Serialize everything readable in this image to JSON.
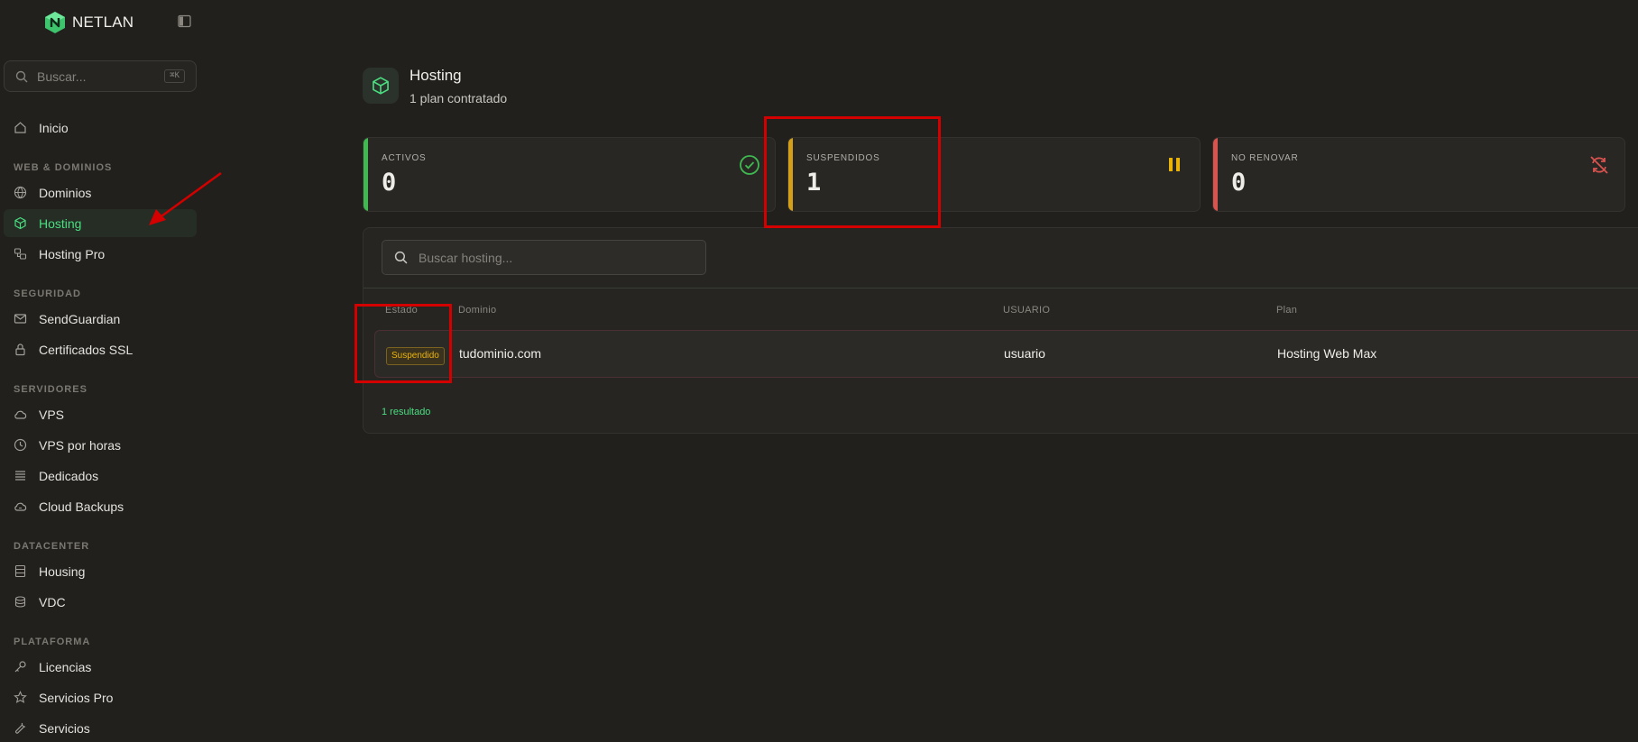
{
  "brand": {
    "name": "NETLAN"
  },
  "sidebar": {
    "search_placeholder": "Buscar...",
    "search_shortcut": "⌘K",
    "home_label": "Inicio",
    "sections": [
      "WEB & DOMINIOS",
      "SEGURIDAD",
      "SERVIDORES",
      "DATACENTER",
      "PLATAFORMA"
    ],
    "items": [
      {
        "label": "Dominios",
        "icon": "globe-icon"
      },
      {
        "label": "Hosting",
        "icon": "cube-icon",
        "active": true
      },
      {
        "label": "Hosting Pro",
        "icon": "server-stack-icon"
      },
      {
        "label": "SendGuardian",
        "icon": "mail-icon"
      },
      {
        "label": "Certificados SSL",
        "icon": "lock-icon"
      },
      {
        "label": "VPS",
        "icon": "cloud-icon"
      },
      {
        "label": "VPS por horas",
        "icon": "clock-icon"
      },
      {
        "label": "Dedicados",
        "icon": "server-icon"
      },
      {
        "label": "Cloud Backups",
        "icon": "cloud-sync-icon"
      },
      {
        "label": "Housing",
        "icon": "rack-icon"
      },
      {
        "label": "VDC",
        "icon": "database-icon"
      },
      {
        "label": "Licencias",
        "icon": "key-icon"
      },
      {
        "label": "Servicios Pro",
        "icon": "star-icon"
      },
      {
        "label": "Servicios",
        "icon": "wrench-icon"
      }
    ]
  },
  "page": {
    "title": "Hosting",
    "subtitle": "1 plan contratado"
  },
  "stats": [
    {
      "label": "ACTIVOS",
      "value": "0",
      "color": "#3fb950",
      "icon": "check-circle-icon"
    },
    {
      "label": "SUSPENDIDOS",
      "value": "1",
      "color": "#d4a017",
      "icon": "pause-icon"
    },
    {
      "label": "NO RENOVAR",
      "value": "0",
      "color": "#d9534f",
      "icon": "no-renew-icon"
    }
  ],
  "table": {
    "search_placeholder": "Buscar hosting...",
    "columns": [
      "Estado",
      "Dominio",
      "USUARIO",
      "Plan"
    ],
    "rows": [
      {
        "estado": "Suspendido",
        "dominio": "tudominio.com",
        "usuario": "usuario",
        "plan": "Hosting Web Max"
      }
    ],
    "result_count": "1 resultado"
  },
  "colors": {
    "accent": "#4ade80",
    "background": "#21201d",
    "warning": "#eab308",
    "annotation": "#d40000"
  }
}
